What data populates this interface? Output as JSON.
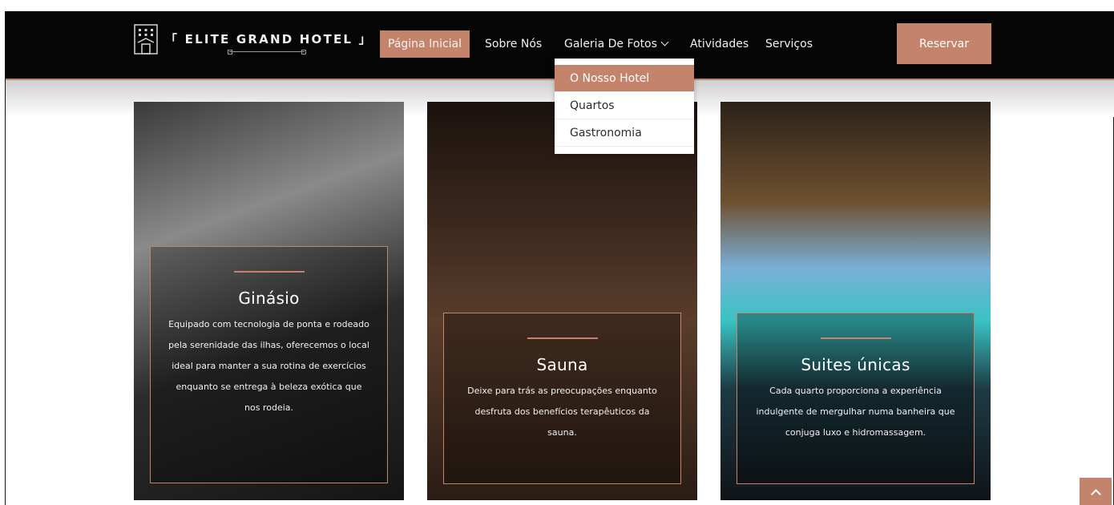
{
  "header": {
    "logo_text": "「 ELITE GRAND HOTEL 」",
    "logo_icon": "hotel-building-icon",
    "nav": [
      {
        "label": "Página Inicial",
        "active": true
      },
      {
        "label": "Sobre Nós"
      },
      {
        "label": "Galeria De Fotos"
      },
      {
        "label": "Atividades"
      },
      {
        "label": "Serviços"
      }
    ],
    "reserve_label": "Reservar"
  },
  "dropdown": {
    "items": [
      "O Nosso Hotel",
      "Quartos",
      "Gastronomia"
    ],
    "active_index": 0
  },
  "cards": [
    {
      "title": "Ginásio",
      "description": "Equipado com tecnologia de ponta e rodeado pela serenidade das ilhas, oferecemos o local ideal para manter a sua rotina de exercícios enquanto se entrega à beleza exótica que nos rodeia."
    },
    {
      "title": "Sauna",
      "description": "Deixe para trás as preocupações enquanto desfruta dos benefícios terapêuticos da sauna."
    },
    {
      "title": "Suites únicas",
      "description": "Cada quarto proporciona a experiência indulgente de mergulhar numa banheira que conjuga luxo e hidromassagem."
    }
  ],
  "colors": {
    "accent": "#c4836b",
    "navbar": "#050505"
  }
}
